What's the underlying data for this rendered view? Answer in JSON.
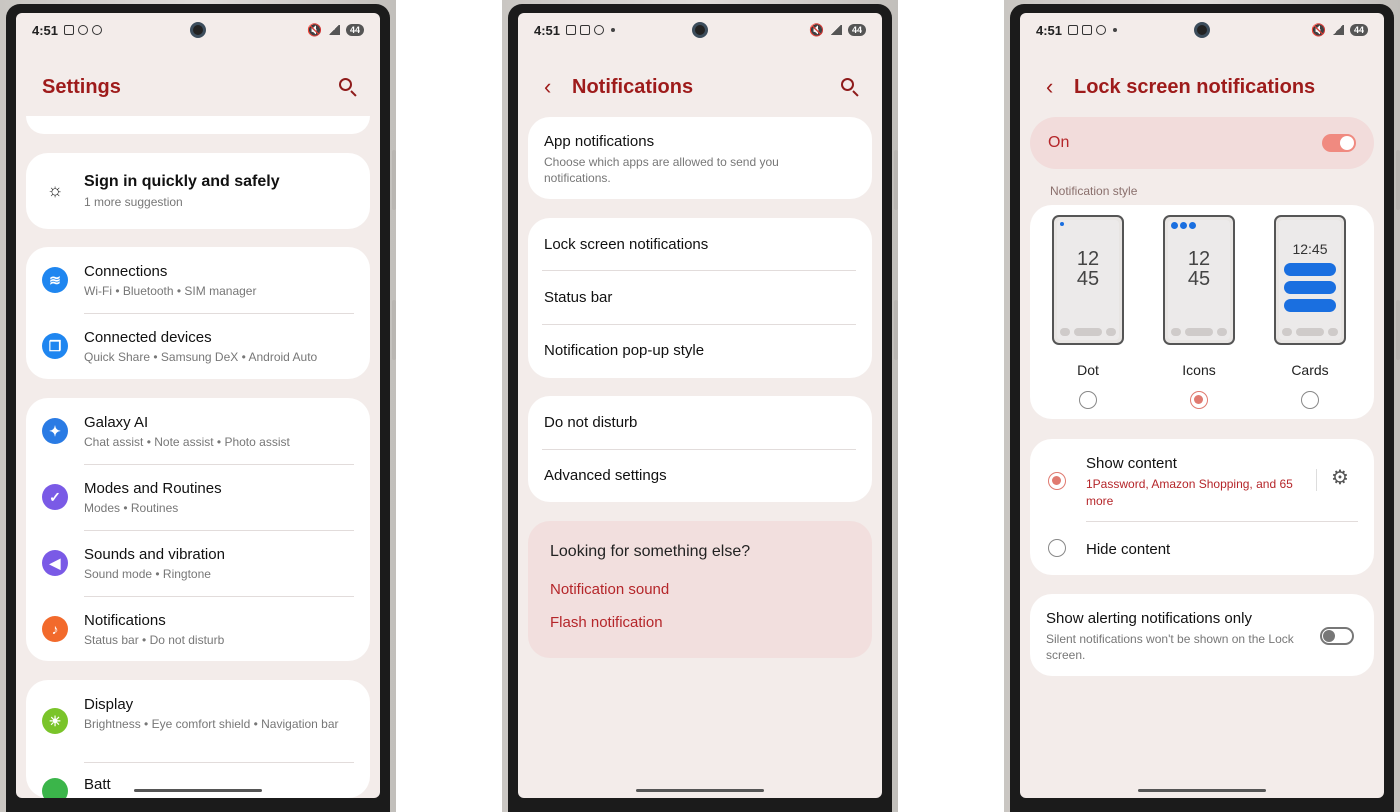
{
  "status": {
    "time": "4:51",
    "battery": "44"
  },
  "screen1": {
    "title": "Settings",
    "suggestion": {
      "title": "Sign in quickly and safely",
      "sub": "1 more suggestion"
    },
    "items": [
      {
        "label": "Connections",
        "sub": "Wi-Fi  •  Bluetooth  •  SIM manager",
        "icon": "wifi-icon",
        "color": "#1f86f0"
      },
      {
        "label": "Connected devices",
        "sub": "Quick Share  •  Samsung DeX  •  Android Auto",
        "icon": "devices-icon",
        "color": "#1f86f0"
      },
      {
        "label": "Galaxy AI",
        "sub": "Chat assist  •  Note assist  •  Photo assist",
        "icon": "sparkle-icon",
        "color": "#2a7be4"
      },
      {
        "label": "Modes and Routines",
        "sub": "Modes  •  Routines",
        "icon": "check-circle-icon",
        "color": "#7a5ae6"
      },
      {
        "label": "Sounds and vibration",
        "sub": "Sound mode  •  Ringtone",
        "icon": "speaker-icon",
        "color": "#7a5ae6"
      },
      {
        "label": "Notifications",
        "sub": "Status bar  •  Do not disturb",
        "icon": "bell-icon",
        "color": "#f26a2c"
      },
      {
        "label": "Display",
        "sub": "Brightness  •  Eye comfort shield  •  Navigation bar",
        "icon": "sun-icon",
        "color": "#7ac42a"
      },
      {
        "label": "Batt",
        "sub": "",
        "icon": "battery-icon",
        "color": "#3bb54a"
      }
    ]
  },
  "screen2": {
    "title": "Notifications",
    "app_notifications": {
      "title": "App notifications",
      "sub": "Choose which apps are allowed to send you notifications."
    },
    "group1": [
      "Lock screen notifications",
      "Status bar",
      "Notification pop-up style"
    ],
    "group2": [
      "Do not disturb",
      "Advanced settings"
    ],
    "help": {
      "question": "Looking for something else?",
      "links": [
        "Notification sound",
        "Flash notification"
      ]
    }
  },
  "screen3": {
    "title": "Lock screen notifications",
    "master": {
      "label": "On",
      "state": true
    },
    "style_header": "Notification style",
    "styles": [
      {
        "label": "Dot",
        "selected": false,
        "clock": [
          "12",
          "45"
        ]
      },
      {
        "label": "Icons",
        "selected": true,
        "clock": [
          "12",
          "45"
        ]
      },
      {
        "label": "Cards",
        "selected": false,
        "clock": [
          "12:45"
        ]
      }
    ],
    "show_content": {
      "label": "Show content",
      "sub": "1Password, Amazon Shopping, and 65 more",
      "selected": true
    },
    "hide_content": {
      "label": "Hide content",
      "selected": false
    },
    "alerting": {
      "label": "Show alerting notifications only",
      "sub": "Silent notifications won't be shown on the Lock screen.",
      "state": false
    }
  },
  "colors": {
    "accent": "#9e1b1b",
    "link": "#b5262a",
    "toggle_on": "#f08a80",
    "toggle_off": "#777777",
    "bg": "#f3ecea"
  }
}
